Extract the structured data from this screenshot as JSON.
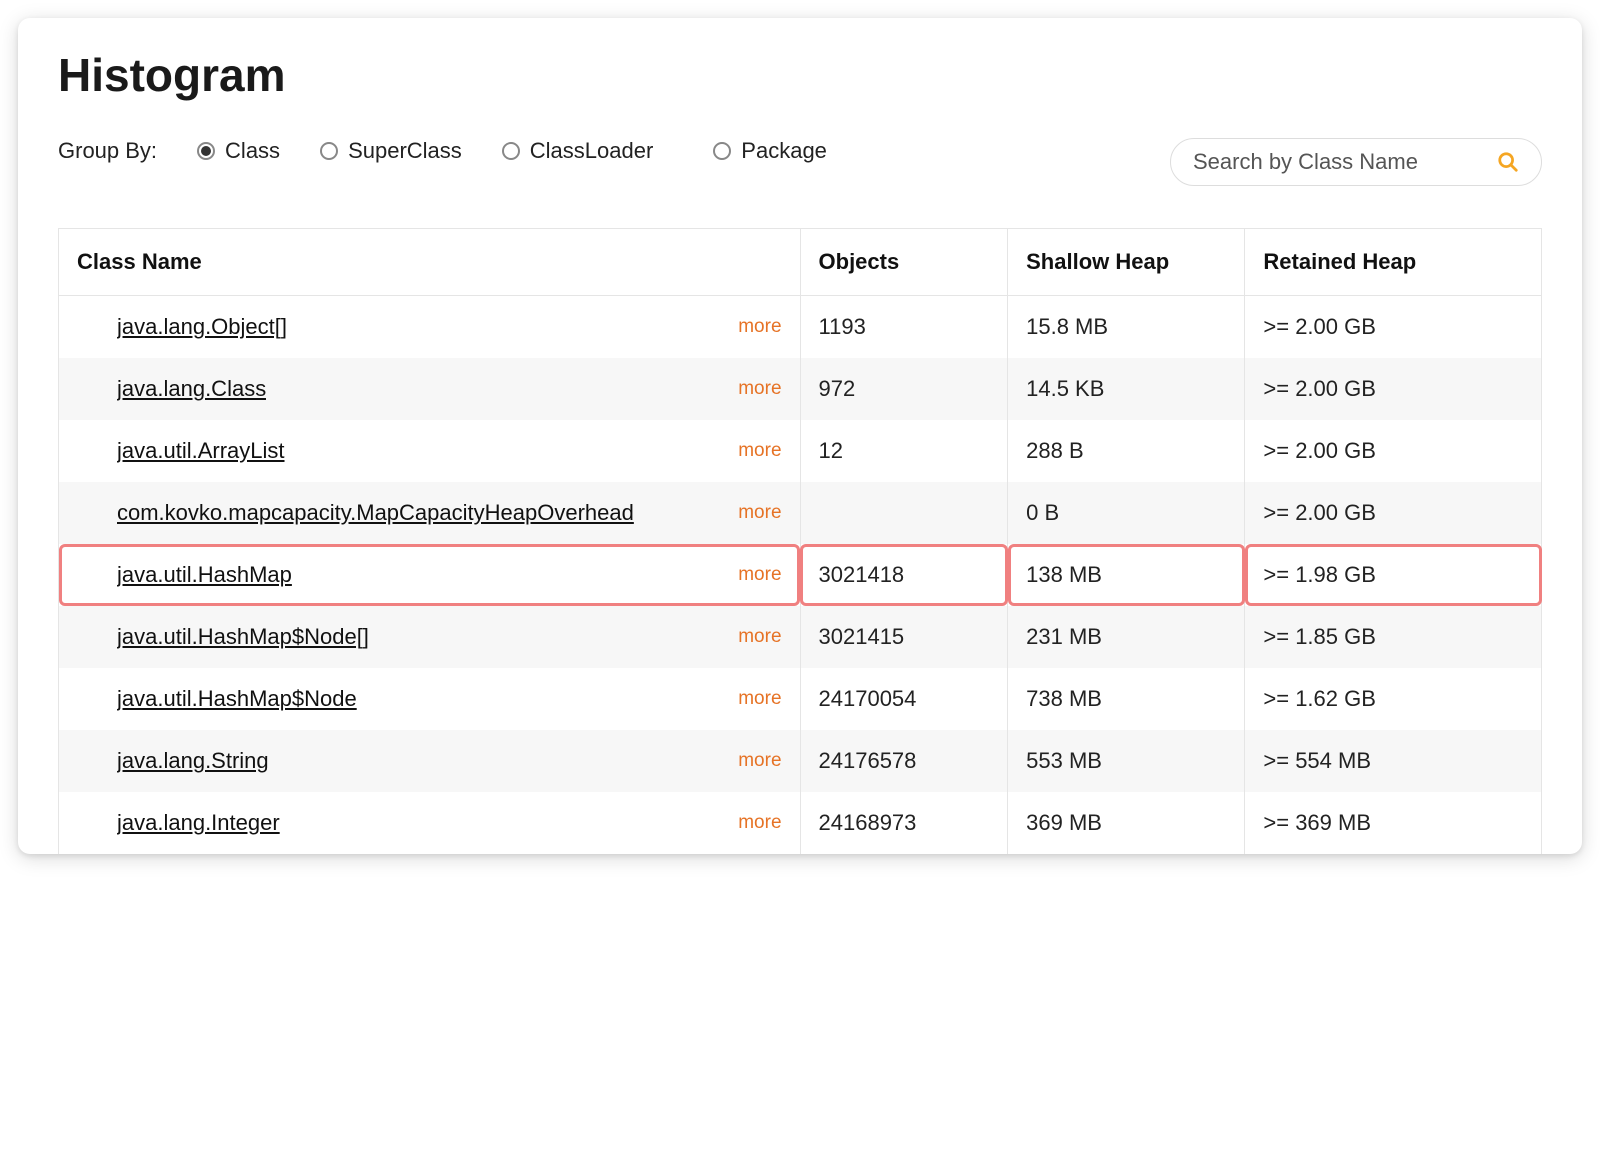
{
  "title": "Histogram",
  "group_by": {
    "label": "Group By:",
    "options": [
      {
        "label": "Class",
        "selected": true
      },
      {
        "label": "SuperClass",
        "selected": false
      },
      {
        "label": "ClassLoader",
        "selected": false
      },
      {
        "label": "Package",
        "selected": false
      }
    ]
  },
  "search": {
    "placeholder": "Search by Class Name"
  },
  "table": {
    "headers": {
      "class_name": "Class Name",
      "objects": "Objects",
      "shallow_heap": "Shallow Heap",
      "retained_heap": "Retained Heap"
    },
    "more_label": "more",
    "rows": [
      {
        "class_name": "java.lang.Object[]",
        "objects": "1193",
        "shallow_heap": "15.8 MB",
        "retained_heap": ">= 2.00 GB",
        "highlighted": false
      },
      {
        "class_name": "java.lang.Class",
        "objects": "972",
        "shallow_heap": "14.5 KB",
        "retained_heap": ">= 2.00 GB",
        "highlighted": false
      },
      {
        "class_name": "java.util.ArrayList",
        "objects": "12",
        "shallow_heap": "288 B",
        "retained_heap": ">= 2.00 GB",
        "highlighted": false
      },
      {
        "class_name": "com.kovko.mapcapacity.MapCapacityHeapOverhead",
        "objects": "",
        "shallow_heap": "0 B",
        "retained_heap": ">= 2.00 GB",
        "highlighted": false
      },
      {
        "class_name": "java.util.HashMap",
        "objects": "3021418",
        "shallow_heap": "138 MB",
        "retained_heap": ">= 1.98 GB",
        "highlighted": true
      },
      {
        "class_name": "java.util.HashMap$Node[]",
        "objects": "3021415",
        "shallow_heap": "231 MB",
        "retained_heap": ">= 1.85 GB",
        "highlighted": false
      },
      {
        "class_name": "java.util.HashMap$Node",
        "objects": "24170054",
        "shallow_heap": "738 MB",
        "retained_heap": ">= 1.62 GB",
        "highlighted": false
      },
      {
        "class_name": "java.lang.String",
        "objects": "24176578",
        "shallow_heap": "553 MB",
        "retained_heap": ">= 554 MB",
        "highlighted": false
      },
      {
        "class_name": "java.lang.Integer",
        "objects": "24168973",
        "shallow_heap": "369 MB",
        "retained_heap": ">= 369 MB",
        "highlighted": false
      }
    ]
  }
}
